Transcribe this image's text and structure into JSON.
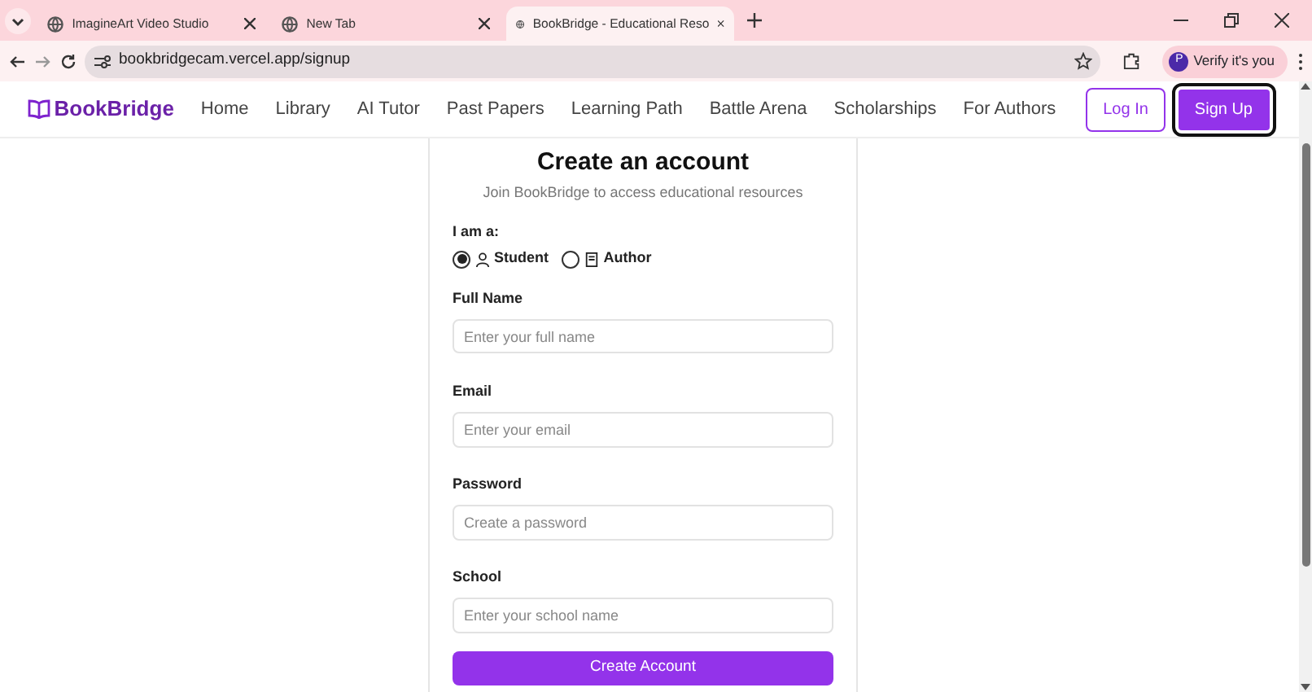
{
  "browser": {
    "tabs": [
      {
        "title": "ImagineArt Video Studio",
        "selected": false
      },
      {
        "title": "New Tab",
        "selected": false
      },
      {
        "title": "BookBridge - Educational Reso",
        "selected": true
      }
    ],
    "address": "bookbridgecam.vercel.app/signup",
    "profile": {
      "label": "Verify it's you",
      "avatar": "P"
    }
  },
  "navbar": {
    "brand": "BookBridge",
    "links": [
      "Home",
      "Library",
      "AI Tutor",
      "Past Papers",
      "Learning Path",
      "Battle Arena",
      "Scholarships",
      "For Authors"
    ],
    "login": "Log In",
    "signup": "Sign Up"
  },
  "form": {
    "title": "Create an account",
    "subtitle": "Join BookBridge to access educational resources",
    "role_label": "I am a:",
    "roles": [
      {
        "label": "Student",
        "kind": "person",
        "selected": true
      },
      {
        "label": "Author",
        "kind": "book",
        "selected": false
      }
    ],
    "fields": [
      {
        "label": "Full Name",
        "placeholder": "Enter your full name"
      },
      {
        "label": "Email",
        "placeholder": "Enter your email"
      },
      {
        "label": "Password",
        "placeholder": "Create a password"
      },
      {
        "label": "School",
        "placeholder": "Enter your school name"
      }
    ],
    "submit": "Create Account"
  }
}
